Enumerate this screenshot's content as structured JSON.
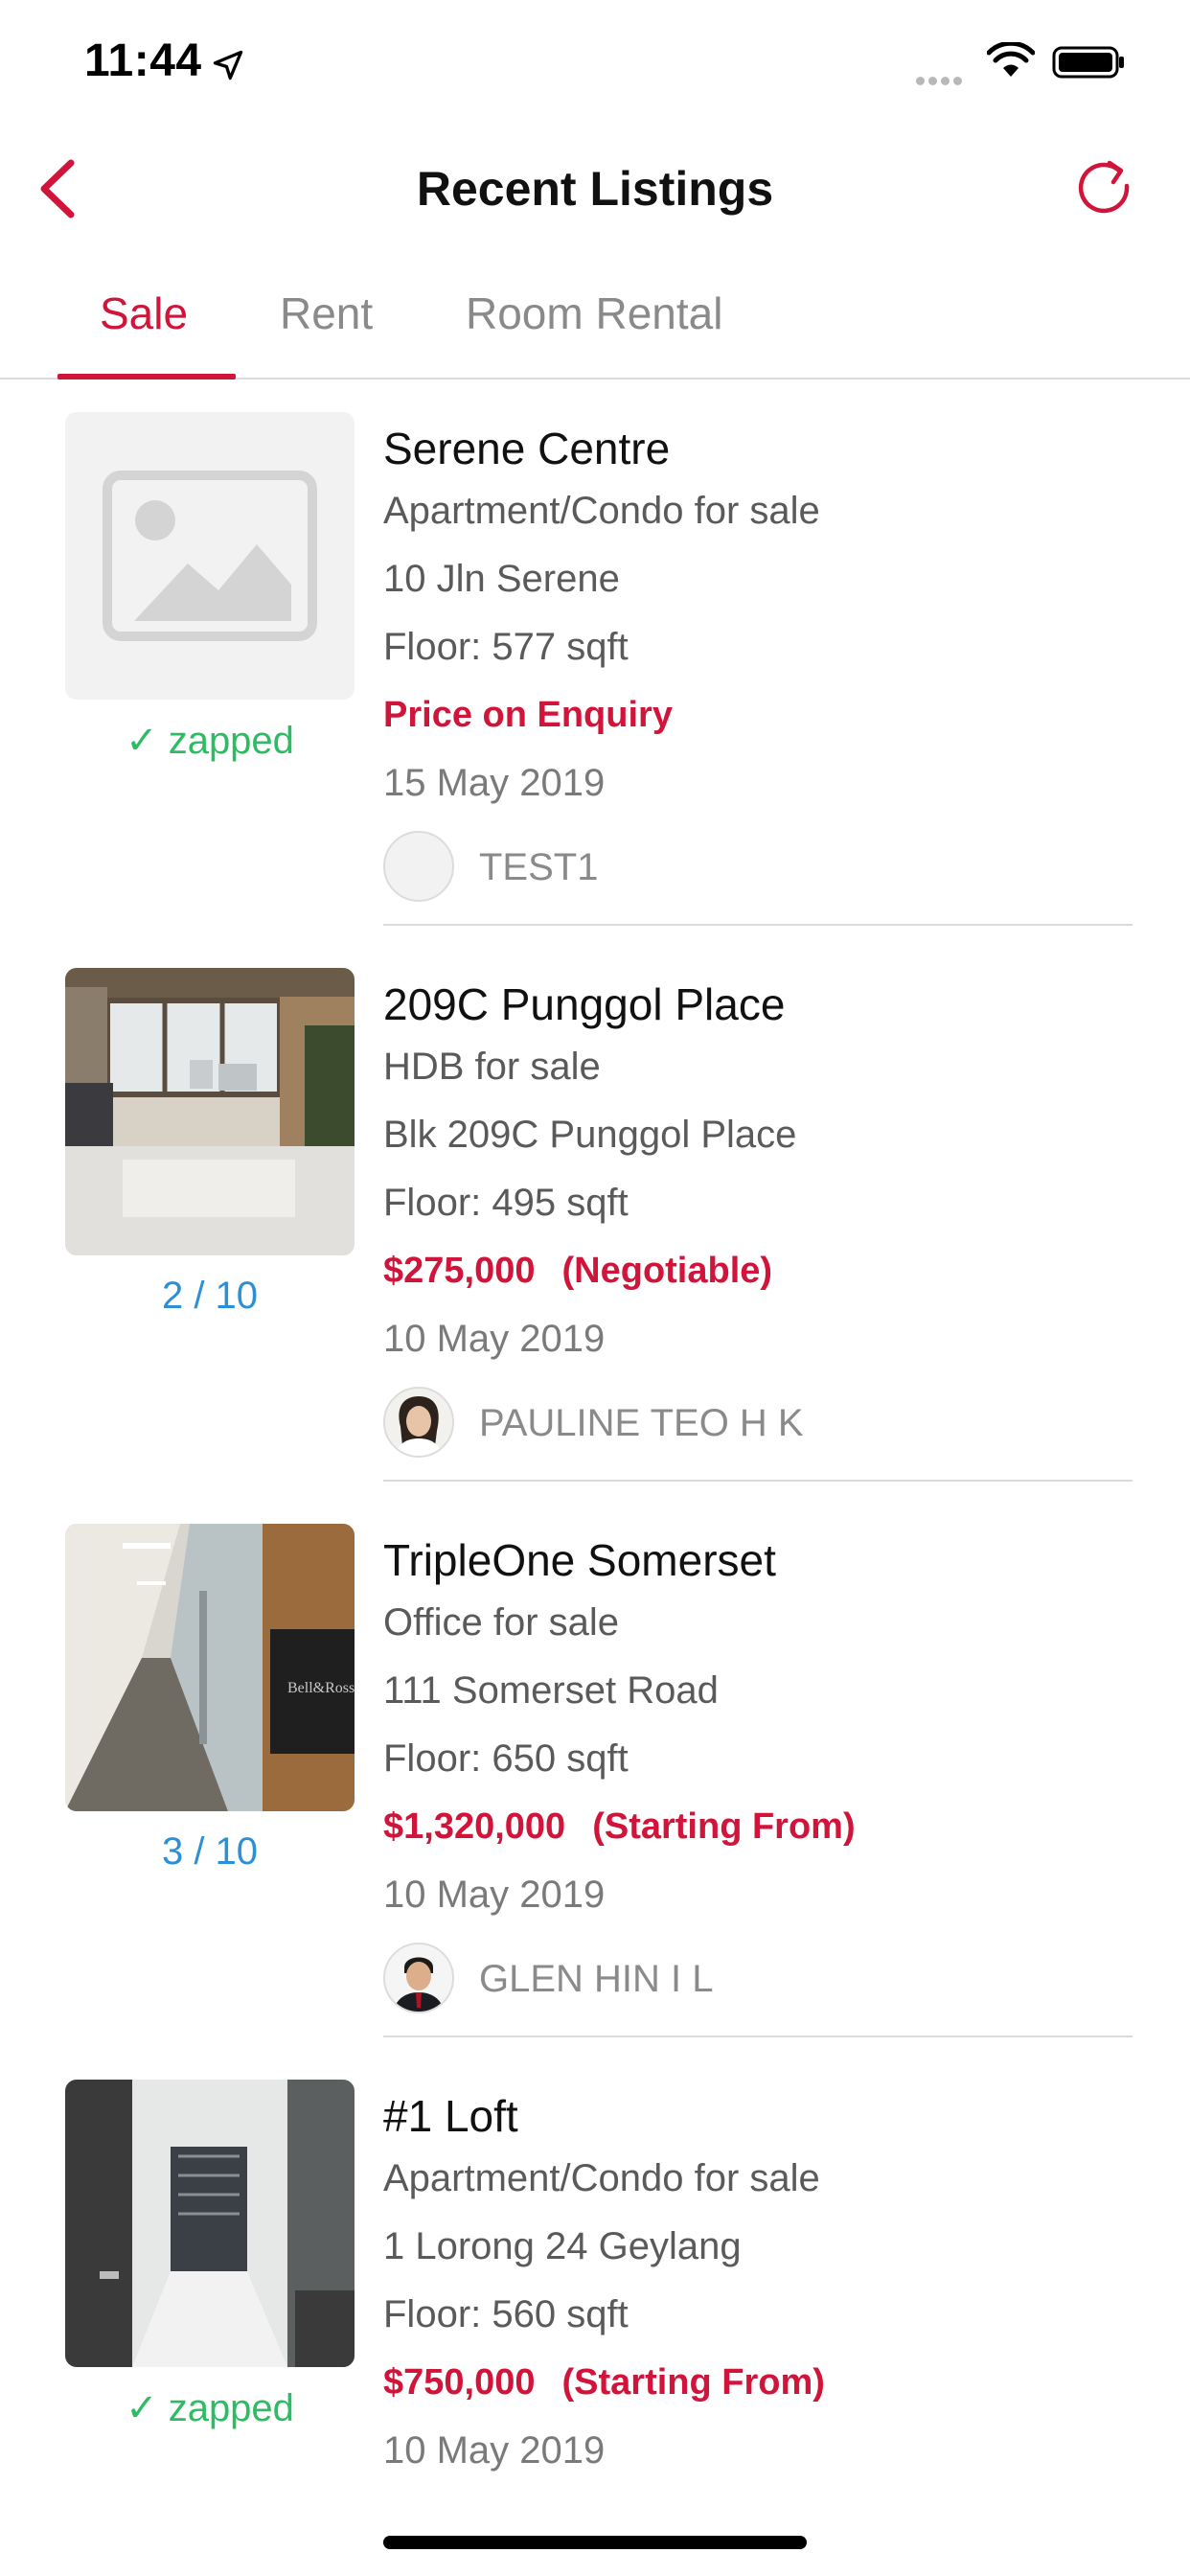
{
  "status_bar": {
    "time": "11:44"
  },
  "nav": {
    "title": "Recent Listings"
  },
  "tabs": [
    {
      "label": "Sale",
      "active": true
    },
    {
      "label": "Rent",
      "active": false
    },
    {
      "label": "Room Rental",
      "active": false
    }
  ],
  "listings": [
    {
      "title": "Serene Centre",
      "type": "Apartment/Condo for sale",
      "address": "10 Jln Serene",
      "floor": "Floor: 577 sqft",
      "price": "Price on Enquiry",
      "price_qualifier": "",
      "date": "15 May 2019",
      "agent": "TEST1",
      "thumb_caption": "✓ zapped",
      "thumb_kind": "placeholder"
    },
    {
      "title": "209C Punggol Place",
      "type": "HDB for sale",
      "address": "Blk 209C Punggol Place",
      "floor": "Floor: 495 sqft",
      "price": "$275,000",
      "price_qualifier": "(Negotiable)",
      "date": "10 May 2019",
      "agent": "PAULINE TEO H K",
      "thumb_caption": "2 / 10",
      "thumb_kind": "photo-room"
    },
    {
      "title": "TripleOne Somerset",
      "type": "Office for sale",
      "address": "111 Somerset Road",
      "floor": "Floor: 650 sqft",
      "price": "$1,320,000",
      "price_qualifier": "(Starting From)",
      "date": "10 May 2019",
      "agent": "GLEN HIN I L",
      "thumb_caption": "3 / 10",
      "thumb_kind": "photo-corridor"
    },
    {
      "title": "#1 Loft",
      "type": "Apartment/Condo for sale",
      "address": "1 Lorong 24 Geylang",
      "floor": "Floor: 560 sqft",
      "price": "$750,000",
      "price_qualifier": "(Starting From)",
      "date": "10 May 2019",
      "agent": "",
      "thumb_caption": "✓ zapped",
      "thumb_kind": "photo-hallway"
    }
  ],
  "colors": {
    "accent": "#d0143a",
    "zapped": "#2dbb63",
    "counter": "#2d8fd6"
  }
}
